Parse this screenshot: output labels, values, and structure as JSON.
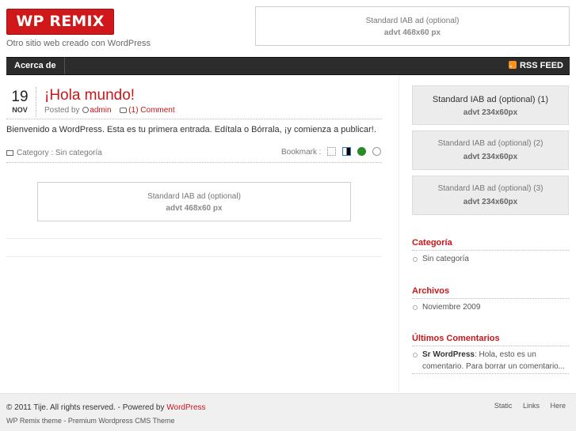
{
  "header": {
    "logo_text": "WP REMIX",
    "tagline": "Otro sitio web creado con WordPress",
    "ad_line1": "Standard IAB ad (optional)",
    "ad_line2": "advt 468x60 px"
  },
  "nav": {
    "items": [
      {
        "label": "Acerca de"
      }
    ],
    "rss_label": "RSS FEED"
  },
  "post": {
    "day": "19",
    "month": "NOV",
    "title": "¡Hola mundo!",
    "posted_by_label": "Posted by",
    "author": "admin",
    "comments": "(1) Comment",
    "body": "Bienvenido a WordPress. Esta es tu primera entrada. Edítala o Bórrala, ¡y comienza a publicar!.",
    "category_label": "Category :",
    "category": "Sin categoría",
    "bookmark_label": "Bookmark :"
  },
  "content_ad": {
    "line1": "Standard IAB ad (optional)",
    "line2": "advt 468x60 px"
  },
  "sidebar": {
    "ads": [
      {
        "line1": "Standard IAB ad (optional)  (1)",
        "line2": "advt 234x60px"
      },
      {
        "line1": "Standard IAB ad (optional) (2)",
        "line2": "advt 234x60px"
      },
      {
        "line1": "Standard IAB ad (optional) (3)",
        "line2": "advt 234x60px"
      }
    ],
    "categories_title": "Categoría",
    "categories": [
      "Sin categoría"
    ],
    "archives_title": "Archivos",
    "archives": [
      "Noviembre 2009"
    ],
    "comments_title": "Últimos Comentarios",
    "recent_comment_author": "Sr WordPress",
    "recent_comment_text": ": Hola, esto es un comentario. Para borrar un comentario..."
  },
  "footer": {
    "copyright_prefix": "© 2011 Tije. All rights reserved. - Powered by",
    "powered_by_link": "WordPress",
    "theme": "WP Remix theme - Premium Wordpress CMS Theme",
    "links": [
      "Static",
      "Links",
      "Here"
    ]
  },
  "colors": {
    "brand_red": "#c8161a",
    "nav_bg": "#2c2c2c",
    "rss_orange": "#f7931e"
  }
}
